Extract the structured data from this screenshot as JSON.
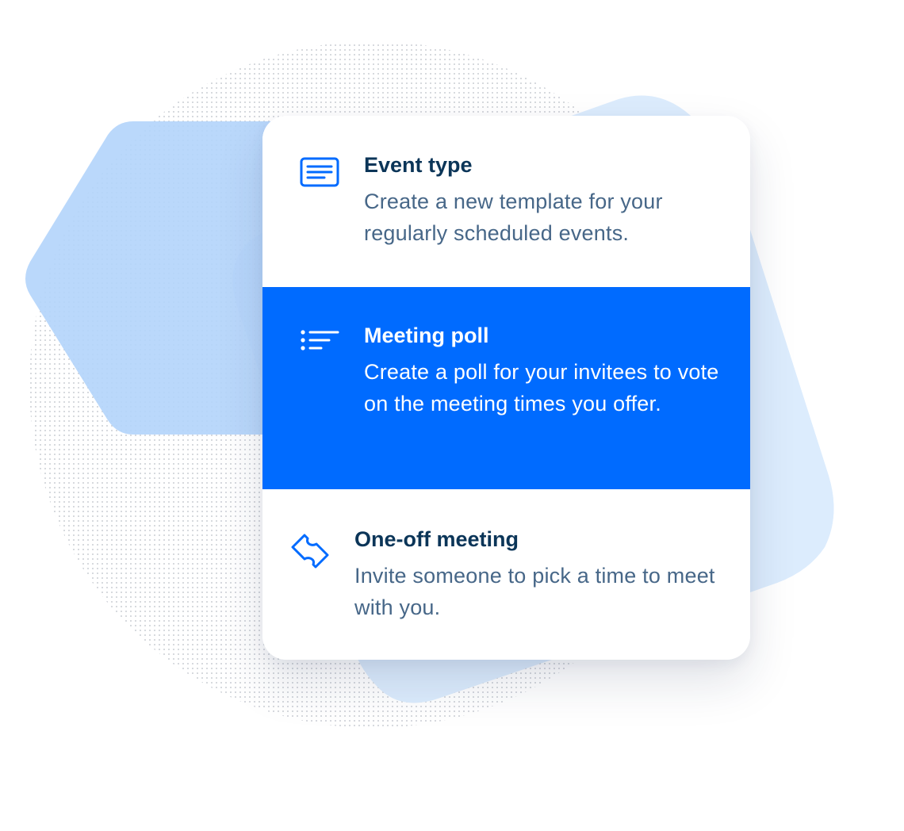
{
  "colors": {
    "accent": "#006bff",
    "title_text": "#0b3558",
    "body_text": "#476788",
    "selected_text": "#ffffff",
    "bg_shape_blue": "#b9d9fb",
    "bg_shape_light": "#d9ebfd"
  },
  "options": [
    {
      "title": "Event type",
      "description": "Create a new template for your regularly scheduled events.",
      "icon": "event-type-icon",
      "selected": false
    },
    {
      "title": "Meeting poll",
      "description": "Create a poll for your invitees to vote on the meeting times you offer.",
      "icon": "meeting-poll-icon",
      "selected": true
    },
    {
      "title": "One-off meeting",
      "description": "Invite someone to pick a time to meet with you.",
      "icon": "ticket-icon",
      "selected": false
    }
  ]
}
